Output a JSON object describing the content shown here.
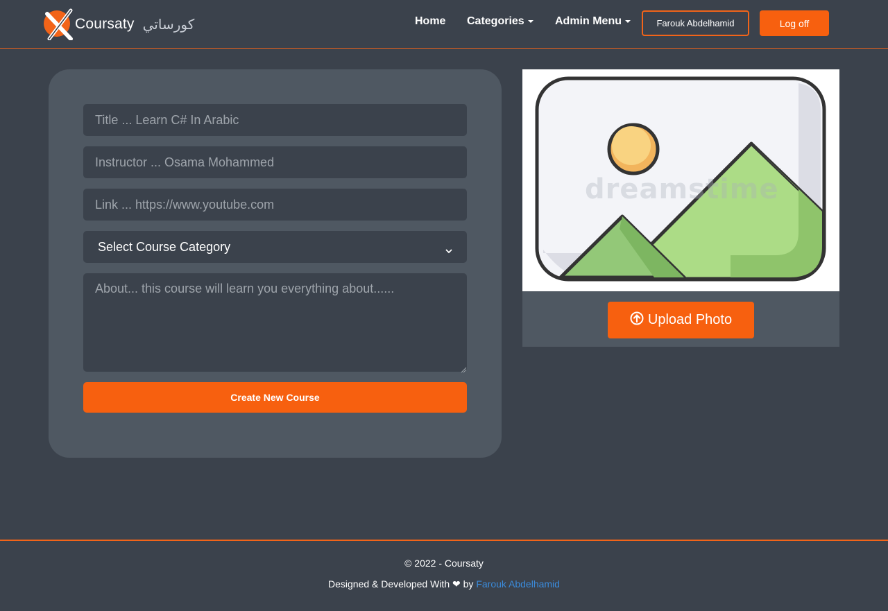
{
  "navbar": {
    "brand_text": "Coursaty",
    "brand_arabic": "كورساتي",
    "links": {
      "home": "Home",
      "categories": "Categories",
      "admin_menu": "Admin Menu"
    },
    "user_name": "Farouk Abdelhamid",
    "logoff_label": "Log off"
  },
  "form": {
    "title_placeholder": "Title ... Learn C# In Arabic",
    "instructor_placeholder": "Instructor ... Osama Mohammed",
    "link_placeholder": "Link ... https://www.youtube.com",
    "category_selected": "Select Course Category",
    "about_placeholder": "About... this course will learn you everything about......",
    "create_button_label": "Create New Course"
  },
  "image_panel": {
    "watermark": "dreamstime",
    "upload_button_label": "Upload Photo"
  },
  "footer": {
    "copyright": "© 2022 - Coursaty",
    "credit_prefix": "Designed & Developed With",
    "credit_by": "by",
    "credit_author": "Farouk Abdelhamid"
  },
  "colors": {
    "accent": "#f7600f",
    "background": "#3b424c",
    "card": "#4f5862",
    "link": "#3b8bdb"
  }
}
